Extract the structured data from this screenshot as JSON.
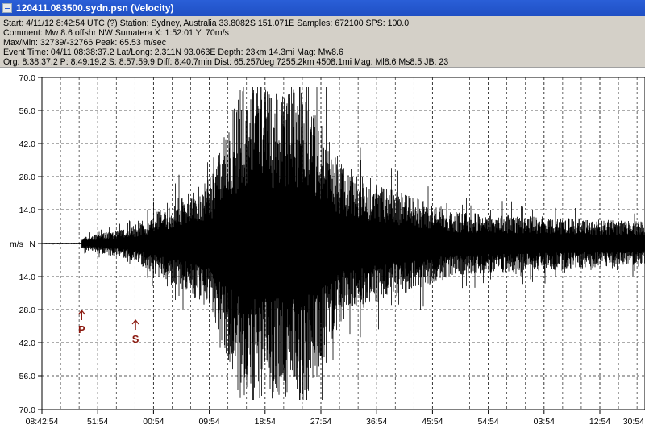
{
  "window": {
    "title": "120411.083500.sydn.psn (Velocity)",
    "icon": "document-icon"
  },
  "info": {
    "lines": [
      "Start: 4/11/12  8:42:54 UTC (?) Station: Sydney, Australia 33.8082S 151.071E Samples: 672100  SPS: 100.0",
      "Comment: Mw 8.6 offshr NW Sumatera   X: 1:52:01 Y: 70m/s",
      "Max/Min: 32739/-32766   Peak: 65.53 m/sec",
      "Event Time: 04/11 08:38:37.2 Lat/Long: 2.311N 93.063E Depth: 23km 14.3mi Mag: Mw8.6",
      "Org: 8:38:37.2 P: 8:49:19.2 S: 8:57:59.9 Diff: 8:40.7min Dist: 65.257deg 7255.2km 4508.1mi  Mag: Ml8.6 Ms8.5 JB: 23"
    ]
  },
  "chart_data": {
    "type": "line",
    "y_tick_labels": [
      "70.0",
      "56.0",
      "42.0",
      "28.0",
      "14.0",
      "N",
      "14.0",
      "28.0",
      "42.0",
      "56.0",
      "70.0"
    ],
    "y_unit_label": "m/s",
    "x_tick_labels": [
      "08:42:54",
      "51:54",
      "00:54",
      "09:54",
      "18:54",
      "27:54",
      "36:54",
      "45:54",
      "54:54",
      "03:54",
      "12:54",
      "21:54",
      "30:54"
    ],
    "grid": true,
    "line_color": "#000000",
    "annotations": [
      {
        "label": "P",
        "time": "8:49:19.2",
        "color": "#8b1a10"
      },
      {
        "label": "S",
        "time": "8:57:59.9",
        "color": "#8b1a10"
      }
    ]
  }
}
